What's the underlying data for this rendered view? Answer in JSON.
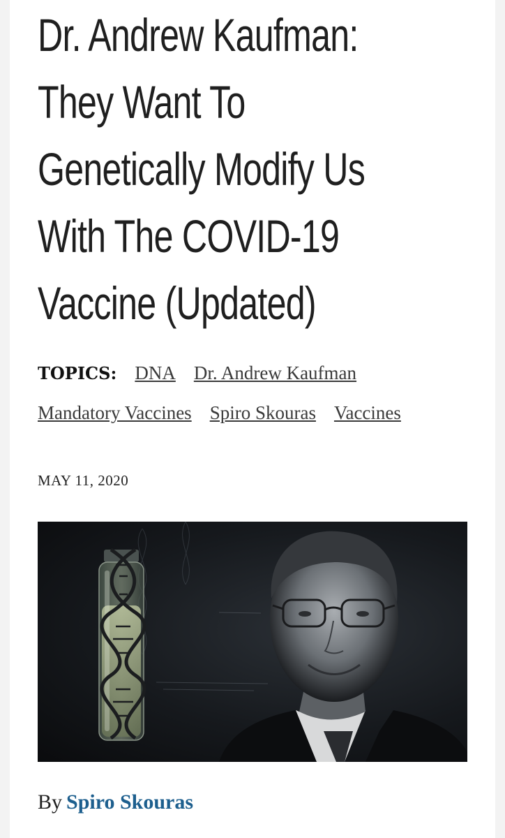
{
  "article": {
    "title_lines": [
      "Dr. Andrew Kaufman:",
      "They Want To",
      "Genetically Modify Us",
      "With The COVID-19",
      "Vaccine (Updated)"
    ],
    "topics_label": "TOPICS:",
    "topics": [
      "DNA",
      "Dr. Andrew Kaufman",
      "Mandatory Vaccines",
      "Spiro Skouras",
      "Vaccines"
    ],
    "date": "MAY 11, 2020",
    "byline_prefix": "By",
    "author": "Spiro Skouras"
  },
  "colors": {
    "title": "#1f1f1f",
    "author_link": "#1d5f8e",
    "background": "#f3f3f3"
  }
}
